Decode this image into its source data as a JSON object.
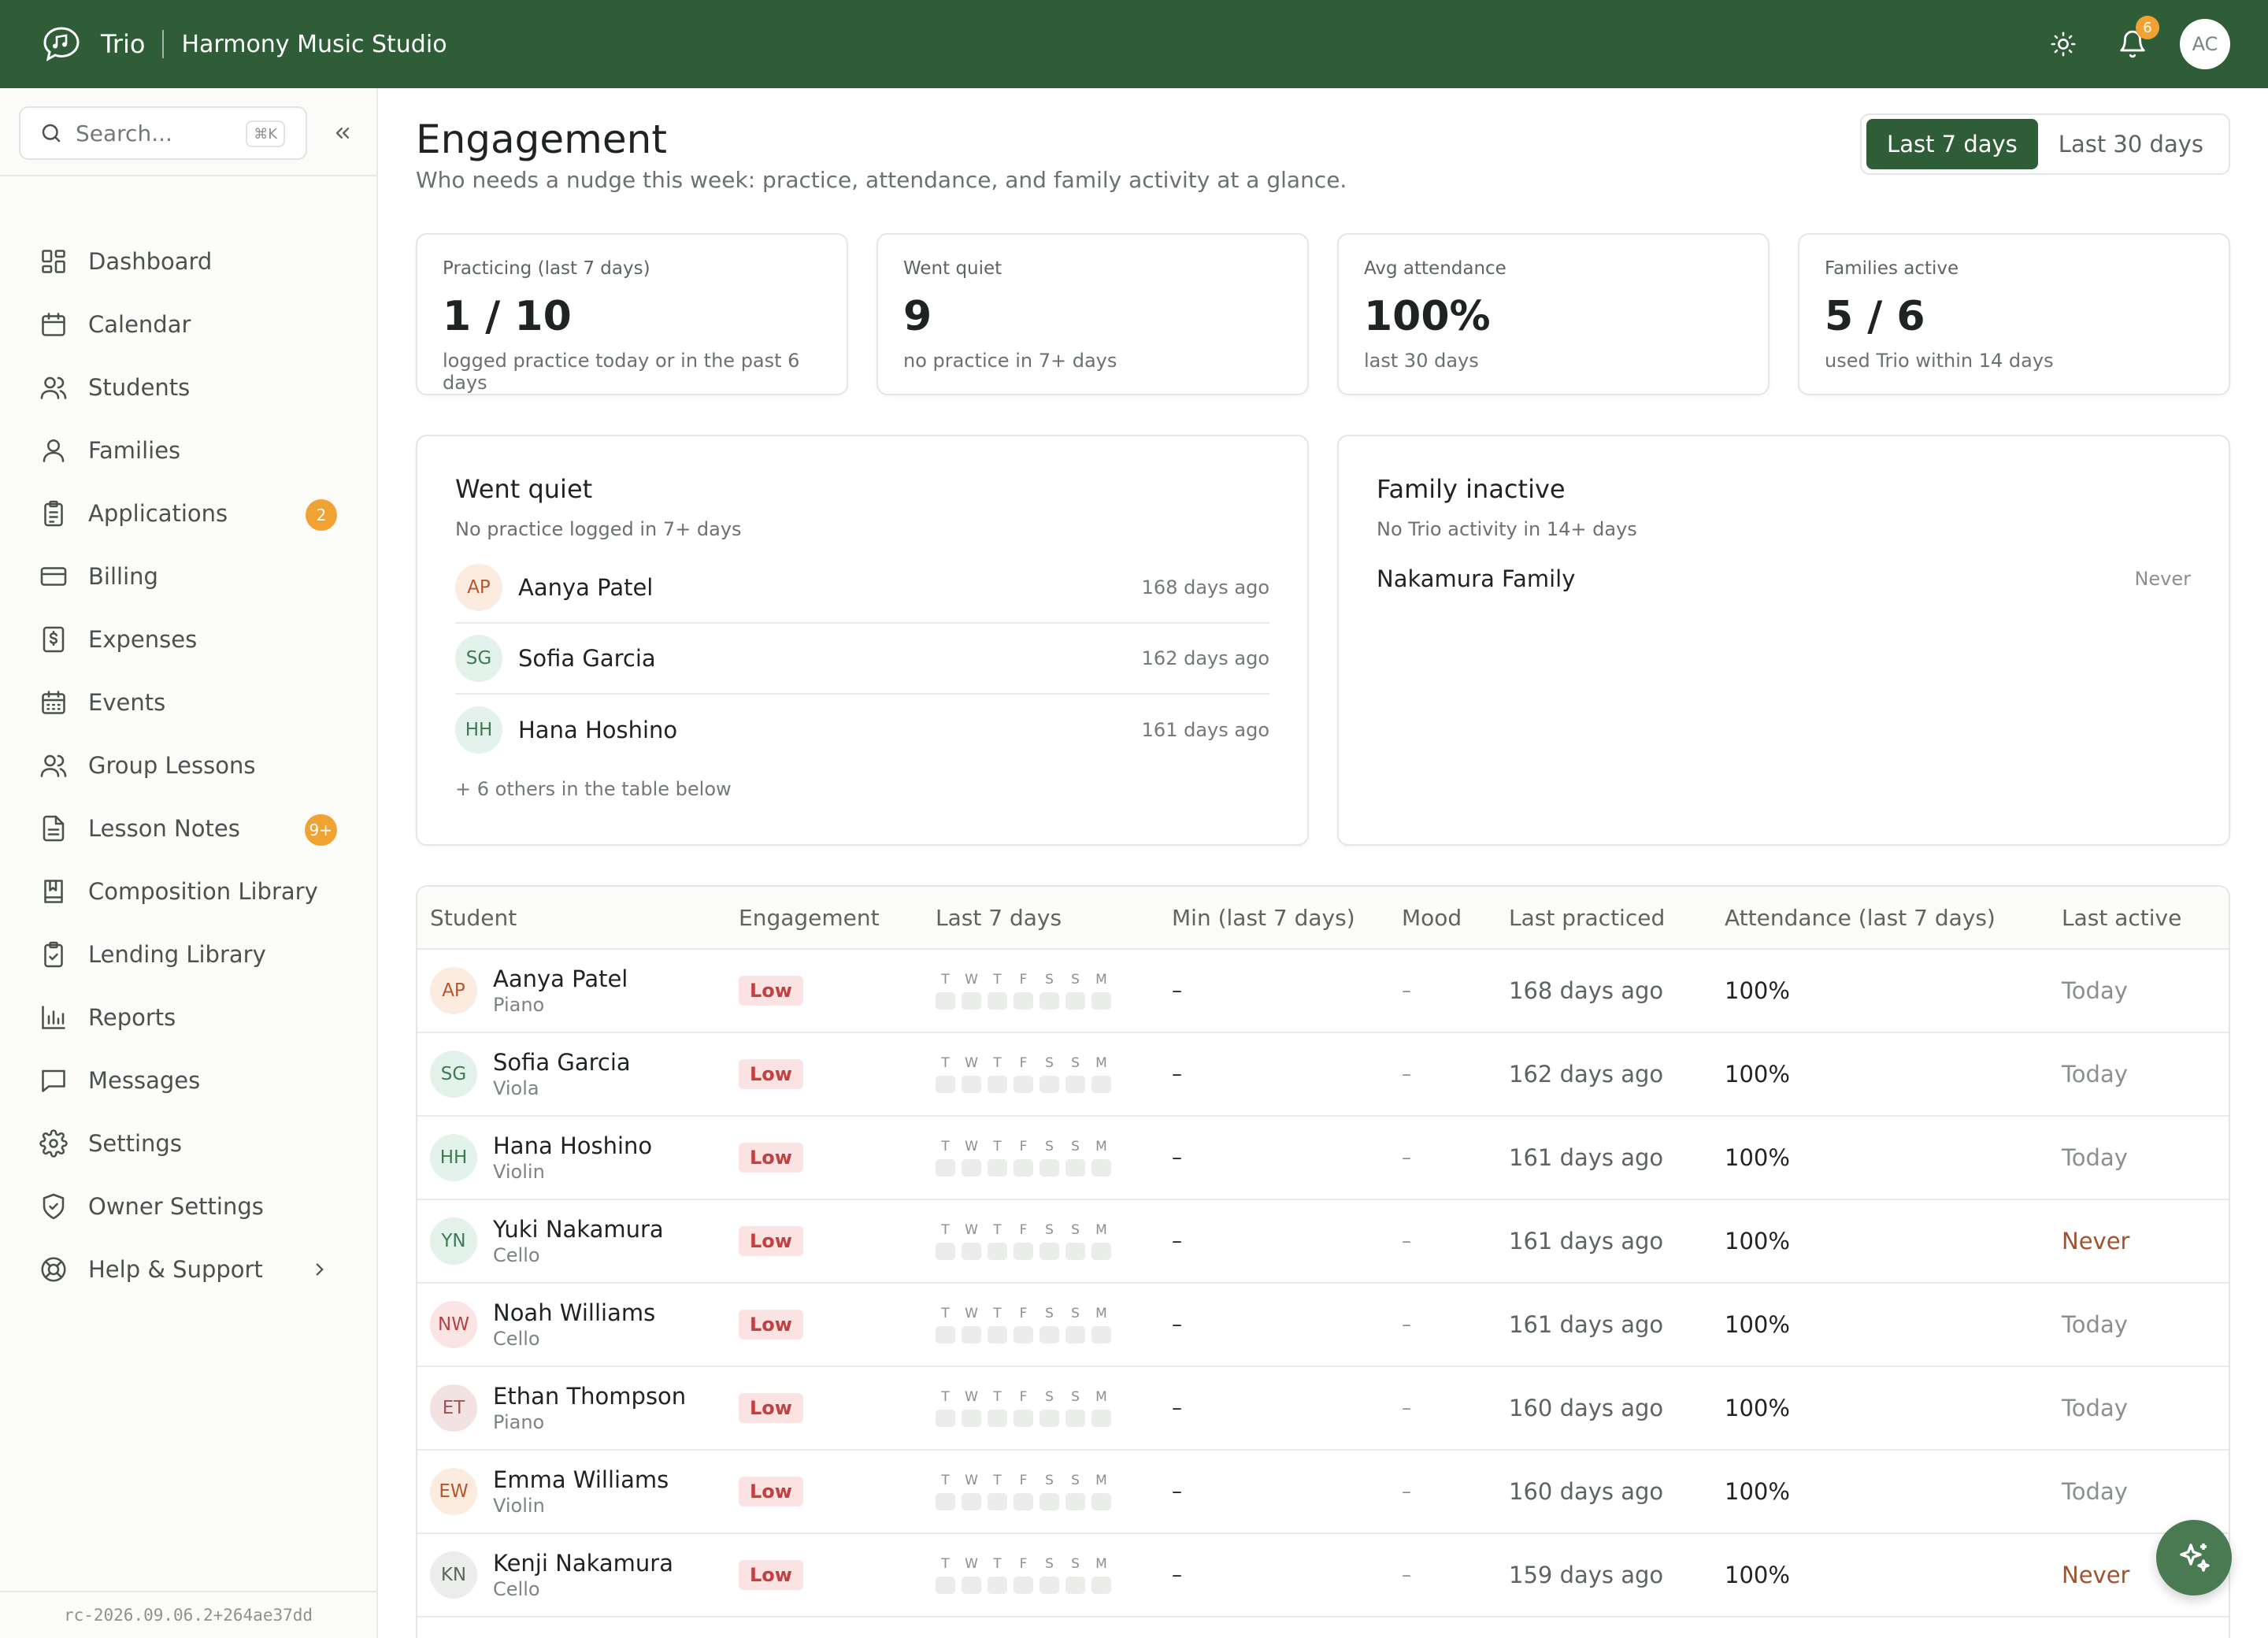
{
  "topbar": {
    "app_name": "Trio",
    "studio_name": "Harmony Music Studio",
    "notifications_count": "6",
    "user_initials": "AC"
  },
  "sidebar": {
    "search_placeholder": "Search...",
    "search_shortcut": "⌘K",
    "items": [
      {
        "label": "Dashboard",
        "icon": "dashboard-icon"
      },
      {
        "label": "Calendar",
        "icon": "calendar-icon"
      },
      {
        "label": "Students",
        "icon": "users-icon"
      },
      {
        "label": "Families",
        "icon": "user-icon"
      },
      {
        "label": "Applications",
        "icon": "clipboard-icon",
        "badge": "2"
      },
      {
        "label": "Billing",
        "icon": "credit-card-icon"
      },
      {
        "label": "Expenses",
        "icon": "receipt-icon"
      },
      {
        "label": "Events",
        "icon": "calendar-grid-icon"
      },
      {
        "label": "Group Lessons",
        "icon": "group-icon"
      },
      {
        "label": "Lesson Notes",
        "icon": "notes-icon",
        "badge": "9+"
      },
      {
        "label": "Composition Library",
        "icon": "book-icon"
      },
      {
        "label": "Lending Library",
        "icon": "clipboard-check-icon"
      },
      {
        "label": "Reports",
        "icon": "bar-chart-icon"
      },
      {
        "label": "Messages",
        "icon": "message-icon"
      },
      {
        "label": "Settings",
        "icon": "gear-icon"
      },
      {
        "label": "Owner Settings",
        "icon": "shield-icon"
      },
      {
        "label": "Help & Support",
        "icon": "lifebuoy-icon"
      }
    ],
    "build_version": "rc-2026.09.06.2+264ae37dd"
  },
  "header": {
    "title": "Engagement",
    "subtitle": "Who needs a nudge this week: practice, attendance, and family activity at a glance.",
    "range_options": [
      "Last 7 days",
      "Last 30 days"
    ],
    "range_selected": "Last 7 days"
  },
  "stats": [
    {
      "label": "Practicing (last 7 days)",
      "value": "1 / 10",
      "caption": "logged practice today or in the past 6 days"
    },
    {
      "label": "Went quiet",
      "value": "9",
      "caption": "no practice in 7+ days"
    },
    {
      "label": "Avg attendance",
      "value": "100%",
      "caption": "last 30 days"
    },
    {
      "label": "Families active",
      "value": "5 / 6",
      "caption": "used Trio within 14 days"
    }
  ],
  "went_quiet": {
    "title": "Went quiet",
    "subtitle": "No practice logged in 7+ days",
    "items": [
      {
        "initials": "AP",
        "name": "Aanya Patel",
        "days": "168 days ago"
      },
      {
        "initials": "SG",
        "name": "Sofia Garcia",
        "days": "162 days ago"
      },
      {
        "initials": "HH",
        "name": "Hana Hoshino",
        "days": "161 days ago"
      }
    ],
    "more": "+ 6 others in the table below"
  },
  "family_inactive": {
    "title": "Family inactive",
    "subtitle": "No Trio activity in 14+ days",
    "items": [
      {
        "name": "Nakamura Family",
        "last": "Never"
      }
    ]
  },
  "table": {
    "headers": [
      "Student",
      "Engagement",
      "Last 7 days",
      "Min (last 7 days)",
      "Mood",
      "Last practiced",
      "Attendance (last 7 days)",
      "Last active"
    ],
    "week_letters": [
      "T",
      "W",
      "T",
      "F",
      "S",
      "S",
      "M"
    ],
    "rows": [
      {
        "initials": "AP",
        "name": "Aanya Patel",
        "instrument": "Piano",
        "engagement": "Low",
        "min": "–",
        "mood": "–",
        "last_practiced": "168 days ago",
        "attendance": "100%",
        "last_active": "Today"
      },
      {
        "initials": "SG",
        "name": "Sofia Garcia",
        "instrument": "Viola",
        "engagement": "Low",
        "min": "–",
        "mood": "–",
        "last_practiced": "162 days ago",
        "attendance": "100%",
        "last_active": "Today"
      },
      {
        "initials": "HH",
        "name": "Hana Hoshino",
        "instrument": "Violin",
        "engagement": "Low",
        "min": "–",
        "mood": "–",
        "last_practiced": "161 days ago",
        "attendance": "100%",
        "last_active": "Today"
      },
      {
        "initials": "YN",
        "name": "Yuki Nakamura",
        "instrument": "Cello",
        "engagement": "Low",
        "min": "–",
        "mood": "–",
        "last_practiced": "161 days ago",
        "attendance": "100%",
        "last_active": "Never"
      },
      {
        "initials": "NW",
        "name": "Noah Williams",
        "instrument": "Cello",
        "engagement": "Low",
        "min": "–",
        "mood": "–",
        "last_practiced": "161 days ago",
        "attendance": "100%",
        "last_active": "Today"
      },
      {
        "initials": "ET",
        "name": "Ethan Thompson",
        "instrument": "Piano",
        "engagement": "Low",
        "min": "–",
        "mood": "–",
        "last_practiced": "160 days ago",
        "attendance": "100%",
        "last_active": "Today"
      },
      {
        "initials": "EW",
        "name": "Emma Williams",
        "instrument": "Violin",
        "engagement": "Low",
        "min": "–",
        "mood": "–",
        "last_practiced": "160 days ago",
        "attendance": "100%",
        "last_active": "Today"
      },
      {
        "initials": "KN",
        "name": "Kenji Nakamura",
        "instrument": "Cello",
        "engagement": "Low",
        "min": "–",
        "mood": "–",
        "last_practiced": "159 days ago",
        "attendance": "100%",
        "last_active": "Never"
      }
    ]
  },
  "colors": {
    "brand": "#2f5d37",
    "accent_badge": "#f0a232",
    "low_badge_bg": "#fbe3e3",
    "low_badge_text": "#c24040",
    "never_text": "#a0522d",
    "fab": "#4a7a52"
  }
}
